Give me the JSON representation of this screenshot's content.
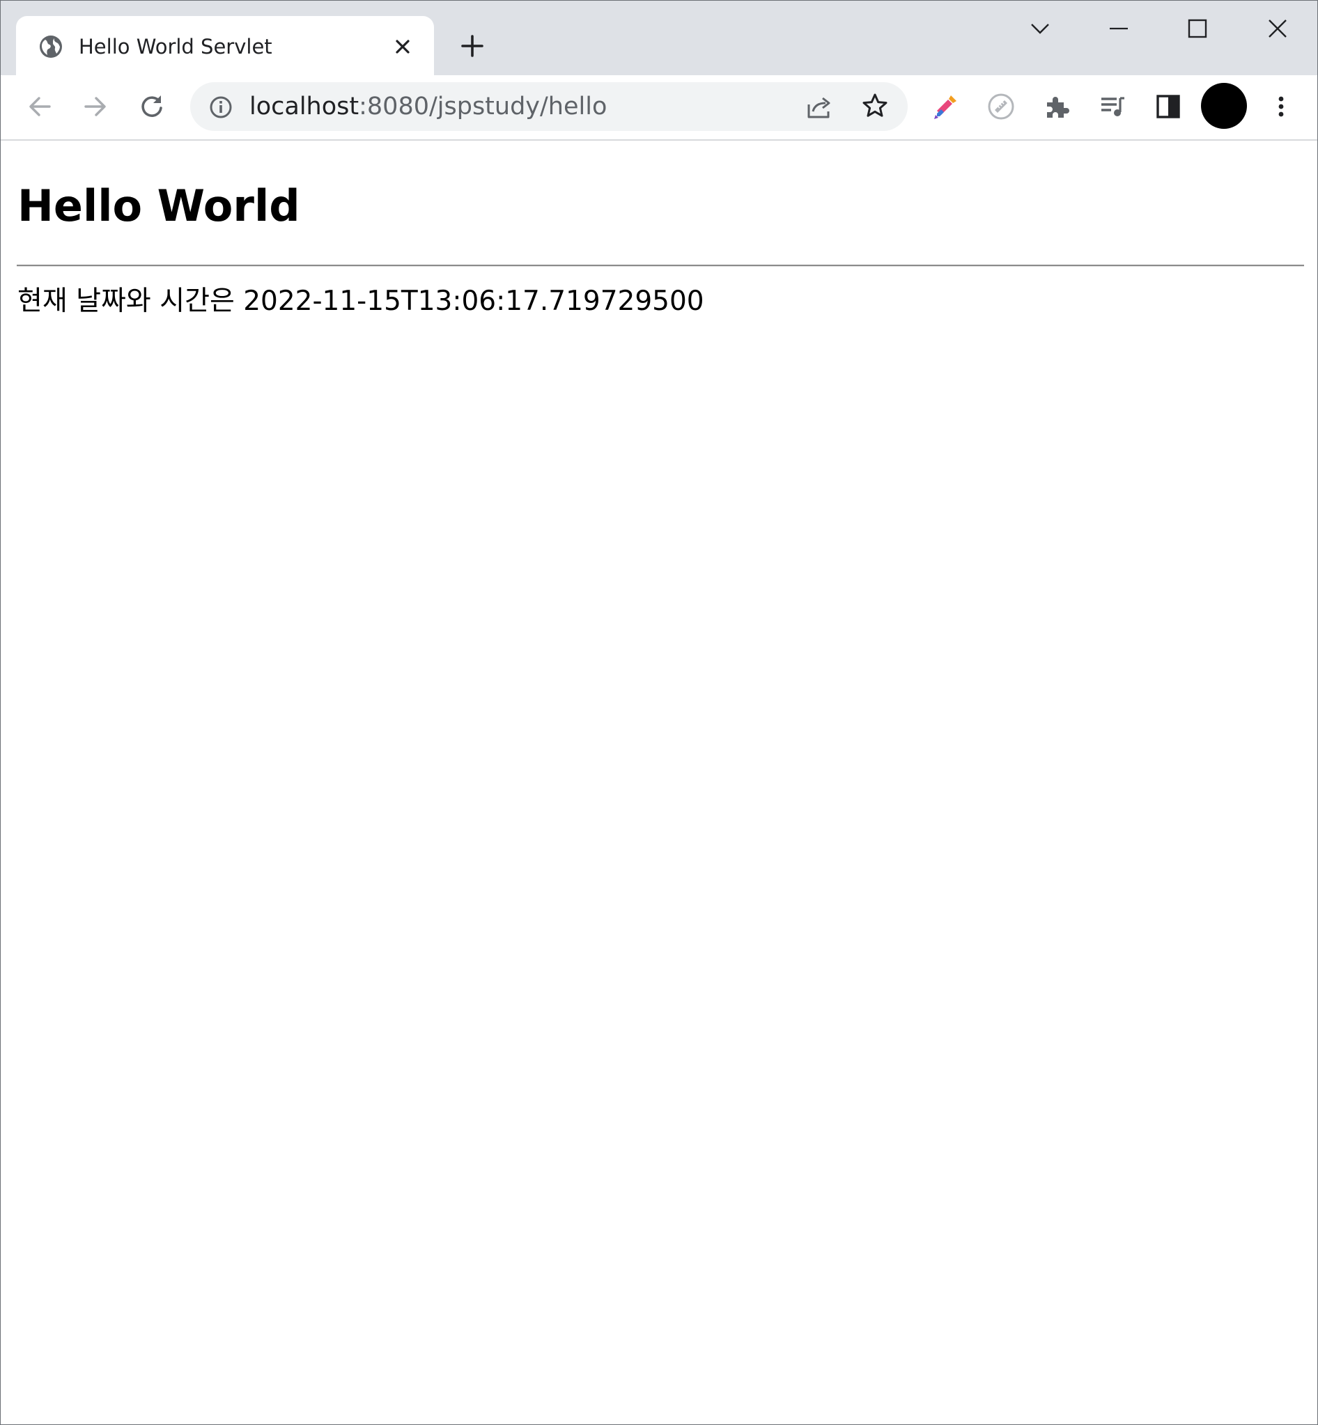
{
  "tab": {
    "title": "Hello World Servlet",
    "favicon": "globe-icon"
  },
  "window_controls": {
    "tab_search": "chevron-down-icon",
    "minimize": "minimize-icon",
    "maximize": "maximize-icon",
    "close": "close-icon"
  },
  "toolbar": {
    "url_host": "localhost",
    "url_rest": ":8080/jspstudy/hello",
    "extensions": [
      "color-picker-icon",
      "ruler-icon",
      "puzzle-icon",
      "reading-list-icon",
      "side-panel-icon"
    ],
    "avatar_color": "#000000"
  },
  "page": {
    "heading": "Hello World",
    "datetime_text": "현재 날짜와 시간은 2022-11-15T13:06:17.719729500"
  },
  "colors": {
    "tabstrip_bg": "#dee1e6",
    "omnibox_bg": "#f1f3f4",
    "icon_gray": "#5f6368"
  }
}
